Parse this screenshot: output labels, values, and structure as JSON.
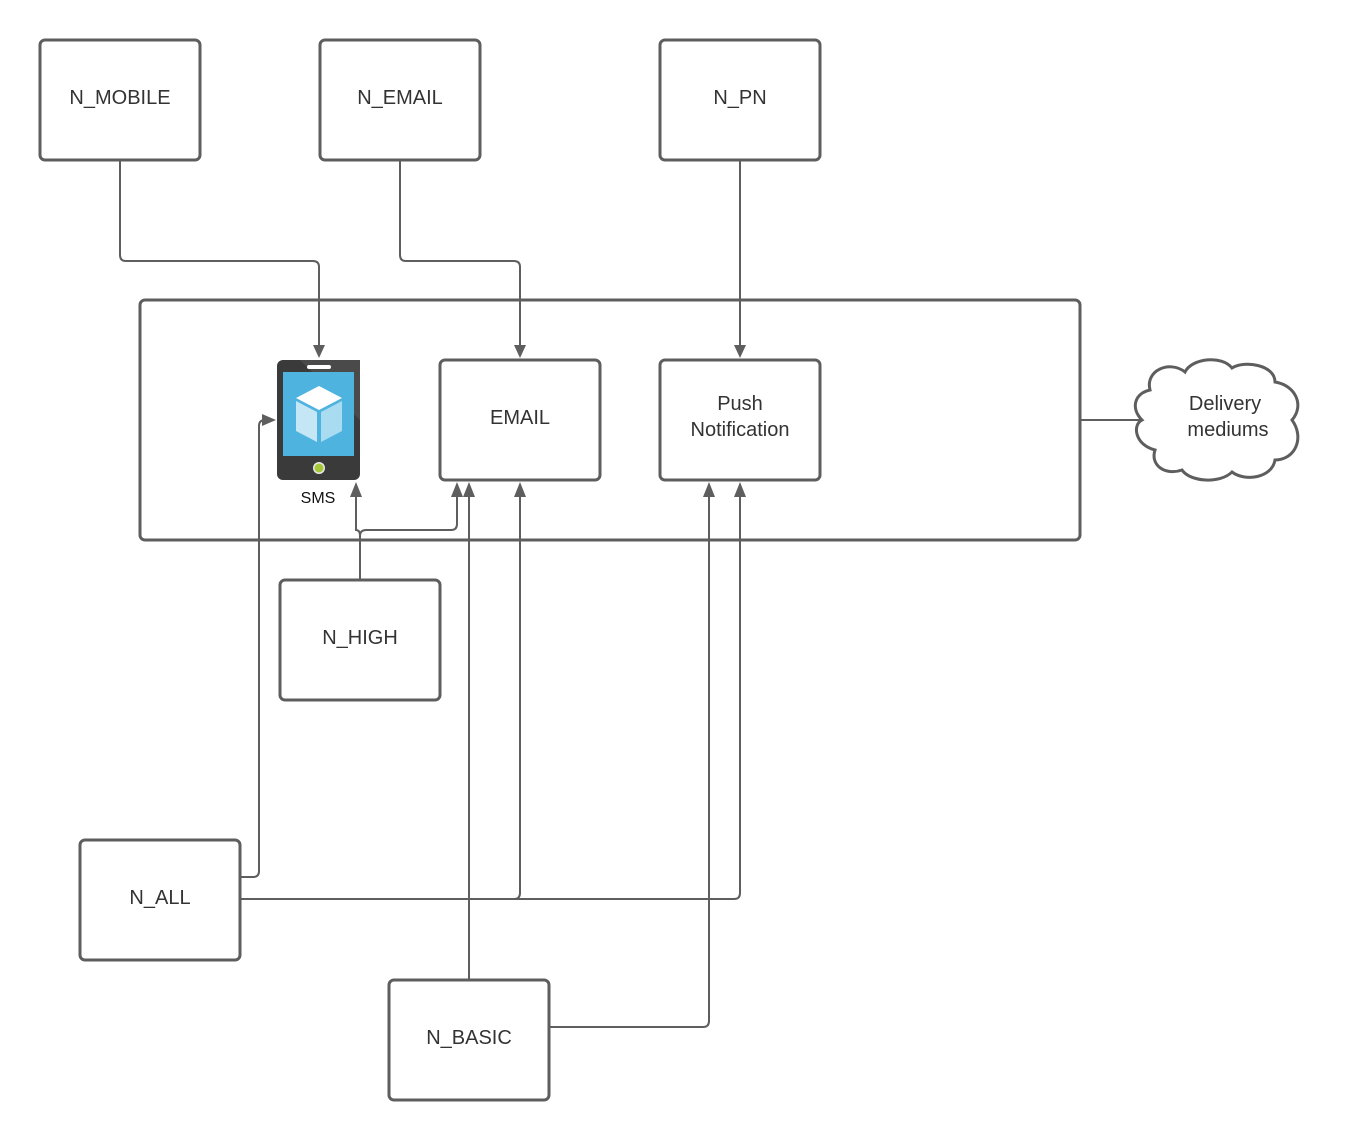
{
  "diagram": {
    "nodes": {
      "n_mobile": "N_MOBILE",
      "n_email": "N_EMAIL",
      "n_pn": "N_PN",
      "email": "EMAIL",
      "push_line1": "Push",
      "push_line2": "Notification",
      "sms": "SMS",
      "n_high": "N_HIGH",
      "n_all": "N_ALL",
      "n_basic": "N_BASIC",
      "cloud_line1": "Delivery",
      "cloud_line2": "mediums"
    },
    "edges": [
      {
        "from": "N_MOBILE",
        "to": "SMS"
      },
      {
        "from": "N_EMAIL",
        "to": "EMAIL"
      },
      {
        "from": "N_PN",
        "to": "Push Notification"
      },
      {
        "from": "N_HIGH",
        "to": "SMS"
      },
      {
        "from": "N_HIGH",
        "to": "EMAIL"
      },
      {
        "from": "N_ALL",
        "to": "SMS"
      },
      {
        "from": "N_ALL",
        "to": "EMAIL"
      },
      {
        "from": "N_ALL",
        "to": "Push Notification"
      },
      {
        "from": "N_BASIC",
        "to": "EMAIL"
      },
      {
        "from": "N_BASIC",
        "to": "Push Notification"
      },
      {
        "from": "Delivery mediums",
        "to": "delivery-container"
      }
    ],
    "colors": {
      "stroke": "#5e5e5e",
      "phone_body": "#3a3a3a",
      "phone_screen": "#4fb3e0",
      "phone_button": "#a5c83a"
    }
  }
}
